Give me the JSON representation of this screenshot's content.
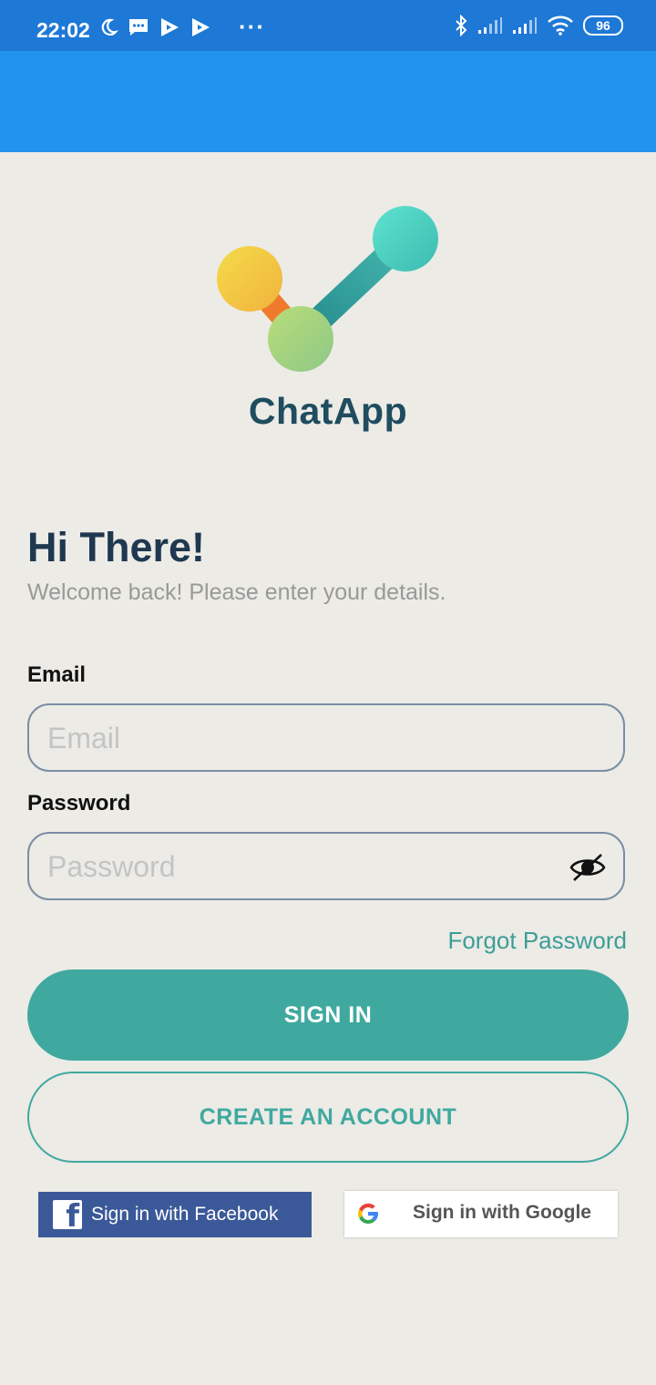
{
  "status_bar": {
    "time": "22:02",
    "battery": "96",
    "left_icons": [
      "moon-icon",
      "message-icon",
      "play-icon",
      "play-icon"
    ],
    "right_icons": [
      "bluetooth-icon",
      "signal-icon",
      "signal-icon",
      "wifi-icon"
    ],
    "overflow": "···"
  },
  "app_bar": {
    "color": "#2394ee"
  },
  "brand": {
    "name": "ChatApp"
  },
  "header": {
    "greeting": "Hi There!",
    "subtitle": "Welcome back! Please enter your details."
  },
  "form": {
    "email": {
      "label": "Email",
      "placeholder": "Email",
      "value": ""
    },
    "password": {
      "label": "Password",
      "placeholder": "Password",
      "value": "",
      "toggle_icon": "eye-off-icon"
    },
    "forgot_label": "Forgot Password",
    "signin_label": "SIGN IN",
    "create_label": "CREATE AN ACCOUNT"
  },
  "social": {
    "facebook_label": "Sign in with Facebook",
    "google_label": "Sign in with Google"
  },
  "colors": {
    "accent": "#40a99f",
    "background": "#ecebe6",
    "status_bar": "#1e78d6",
    "title": "#1f3850",
    "facebook": "#3b5998"
  }
}
